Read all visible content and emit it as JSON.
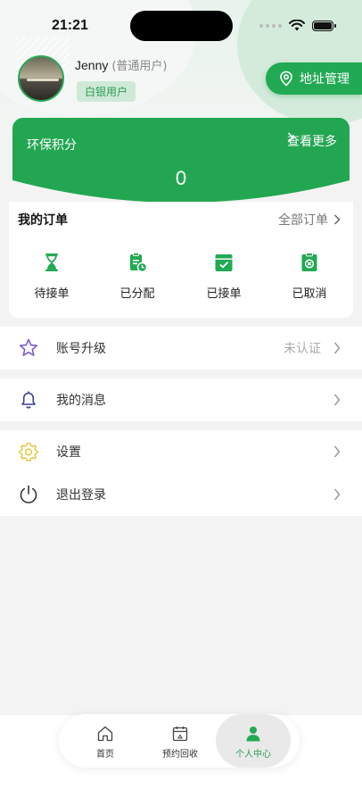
{
  "status_bar": {
    "time": "21:21"
  },
  "profile": {
    "name": "Jenny",
    "role": "(普通用户)",
    "level": "白银用户",
    "address_button": "地址管理"
  },
  "points": {
    "title": "环保积分",
    "more": "查看更多",
    "value": "0"
  },
  "orders": {
    "title": "我的订单",
    "all": "全部订单",
    "items": [
      {
        "label": "待接单",
        "icon": "hourglass-icon"
      },
      {
        "label": "已分配",
        "icon": "clipboard-clock-icon"
      },
      {
        "label": "已接单",
        "icon": "calendar-check-icon"
      },
      {
        "label": "已取消",
        "icon": "clipboard-x-icon"
      }
    ]
  },
  "menu": [
    {
      "label": "账号升级",
      "status": "未认证",
      "icon": "star-icon"
    },
    {
      "label": "我的消息",
      "icon": "bell-icon"
    },
    {
      "label": "设置",
      "icon": "gear-icon"
    },
    {
      "label": "退出登录",
      "icon": "power-icon"
    }
  ],
  "tabbar": [
    {
      "label": "首页",
      "icon": "home-icon"
    },
    {
      "label": "预约回收",
      "icon": "calendar-icon"
    },
    {
      "label": "个人中心",
      "icon": "person-icon",
      "active": true
    }
  ],
  "colors": {
    "accent": "#22a954",
    "badge_bg": "#cfe9d7",
    "page_bg": "#f3f3f3"
  }
}
